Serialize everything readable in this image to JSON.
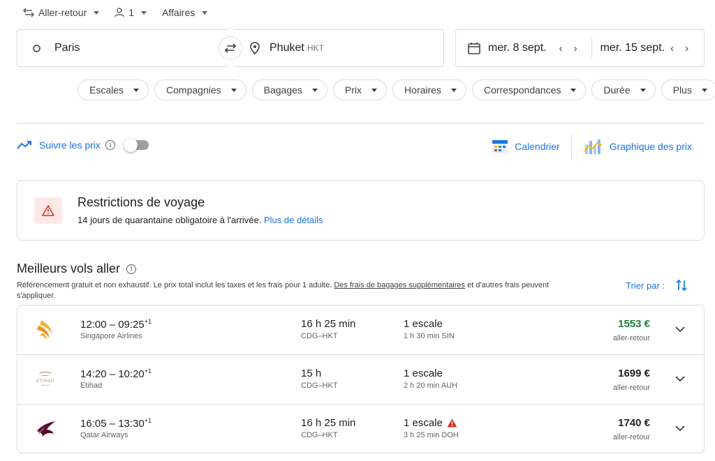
{
  "top": {
    "trip_type": "Aller-retour",
    "passengers": "1",
    "cabin": "Affaires"
  },
  "search": {
    "origin": "Paris",
    "destination": "Phuket",
    "destination_code": "HKT",
    "depart_date": "mer. 8 sept.",
    "return_date": "mer. 15 sept."
  },
  "filters": [
    "Escales",
    "Compagnies",
    "Bagages",
    "Prix",
    "Horaires",
    "Correspondances",
    "Durée",
    "Plus"
  ],
  "tracking": {
    "label": "Suivre les prix",
    "info": "i",
    "enabled_fraction": 0
  },
  "views": {
    "calendar": "Calendrier",
    "price_graph": "Graphique des prix"
  },
  "restrictions": {
    "title": "Restrictions de voyage",
    "text": "14 jours de quarantaine obligatoire à l'arrivée.",
    "link": "Plus de détails"
  },
  "best": {
    "title": "Meilleurs vols aller",
    "disclaimer_part1": "Référencement gratuit et non exhaustif. Le prix total inclut les taxes et les frais pour 1 adulte.",
    "disclaimer_link": "Des frais de bagages supplémentaires",
    "disclaimer_part2": "et d'autres frais peuvent s'appliquer.",
    "sort_label": "Trier par :"
  },
  "flights": [
    {
      "times": "12:00 – 09:25",
      "day_offset": "+1",
      "airline": "Singapore Airlines",
      "duration": "16 h 25 min",
      "route": "CDG–HKT",
      "stops": "1 escale",
      "stop_info": "1 h 30 min SIN",
      "price": "1553 €",
      "price_note": "aller-retour",
      "warning": false,
      "price_color": "#188038"
    },
    {
      "times": "14:20 – 10:20",
      "day_offset": "+1",
      "airline": "Etihad",
      "duration": "15 h",
      "route": "CDG–HKT",
      "stops": "1 escale",
      "stop_info": "2 h 20 min AUH",
      "price": "1699 €",
      "price_note": "aller-retour",
      "warning": false,
      "price_color": "#202124"
    },
    {
      "times": "16:05 – 13:30",
      "day_offset": "+1",
      "airline": "Qatar Airways",
      "duration": "16 h 25 min",
      "route": "CDG–HKT",
      "stops": "1 escale",
      "stop_info": "3 h 25 min DOH",
      "price": "1740 €",
      "price_note": "aller-retour",
      "warning": true,
      "price_color": "#202124"
    }
  ],
  "colors": {
    "accent": "#1a73e8",
    "good_price": "#188038",
    "warning": "#d93025"
  }
}
